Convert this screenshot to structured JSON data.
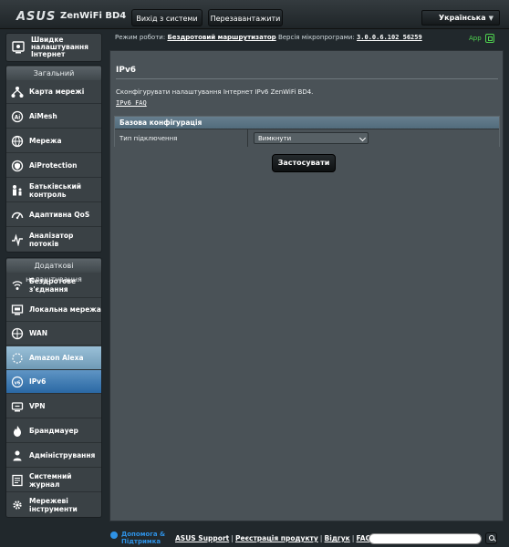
{
  "header": {
    "brand": "ASUS",
    "model": "ZenWiFi BD4",
    "logout_label": "Вихід з системи",
    "reboot_label": "Перезавантажити",
    "language": "Українська"
  },
  "status": {
    "mode_label": "Режим роботи:",
    "mode_value": "Бездротовий маршрутизатор",
    "firmware_label": "Версія мікропрограми:",
    "firmware_value": "3.0.0.6.102_56259",
    "app_label": "App"
  },
  "sidebar": {
    "quick_internet": "Швидке налаштування Інтернет",
    "general_title": "Загальний",
    "general_items": [
      {
        "label": "Карта мережі"
      },
      {
        "label": "AiMesh"
      },
      {
        "label": "Мережа"
      },
      {
        "label": "AiProtection"
      },
      {
        "label": "Батьківський контроль"
      },
      {
        "label": "Адаптивна QoS"
      },
      {
        "label": "Аналізатор потоків"
      }
    ],
    "advanced_title": "Додаткові налаштування",
    "advanced_items": [
      {
        "label": "Бездротове з'єднання"
      },
      {
        "label": "Локальна мережа"
      },
      {
        "label": "WAN"
      },
      {
        "label": "Amazon Alexa"
      },
      {
        "label": "IPv6"
      },
      {
        "label": "VPN"
      },
      {
        "label": "Брандмауер"
      },
      {
        "label": "Адміністрування"
      },
      {
        "label": "Системний журнал"
      },
      {
        "label": "Мережеві інструменти"
      }
    ]
  },
  "main": {
    "title": "IPv6",
    "description": "Сконфігурувати налаштування Інтернет IPv6 ZenWiFi BD4.",
    "faq_link": "IPv6 FAQ",
    "section_title": "Базова конфігурація",
    "connection_type_label": "Тип підключення",
    "connection_type_value": "Вимкнути",
    "apply_label": "Застосувати"
  },
  "footer": {
    "help_line1": "Допомога &",
    "help_line2": "Підтримка",
    "links": [
      "ASUS Support",
      "Реєстрація продукту",
      "Відгук",
      "FAQ"
    ]
  }
}
